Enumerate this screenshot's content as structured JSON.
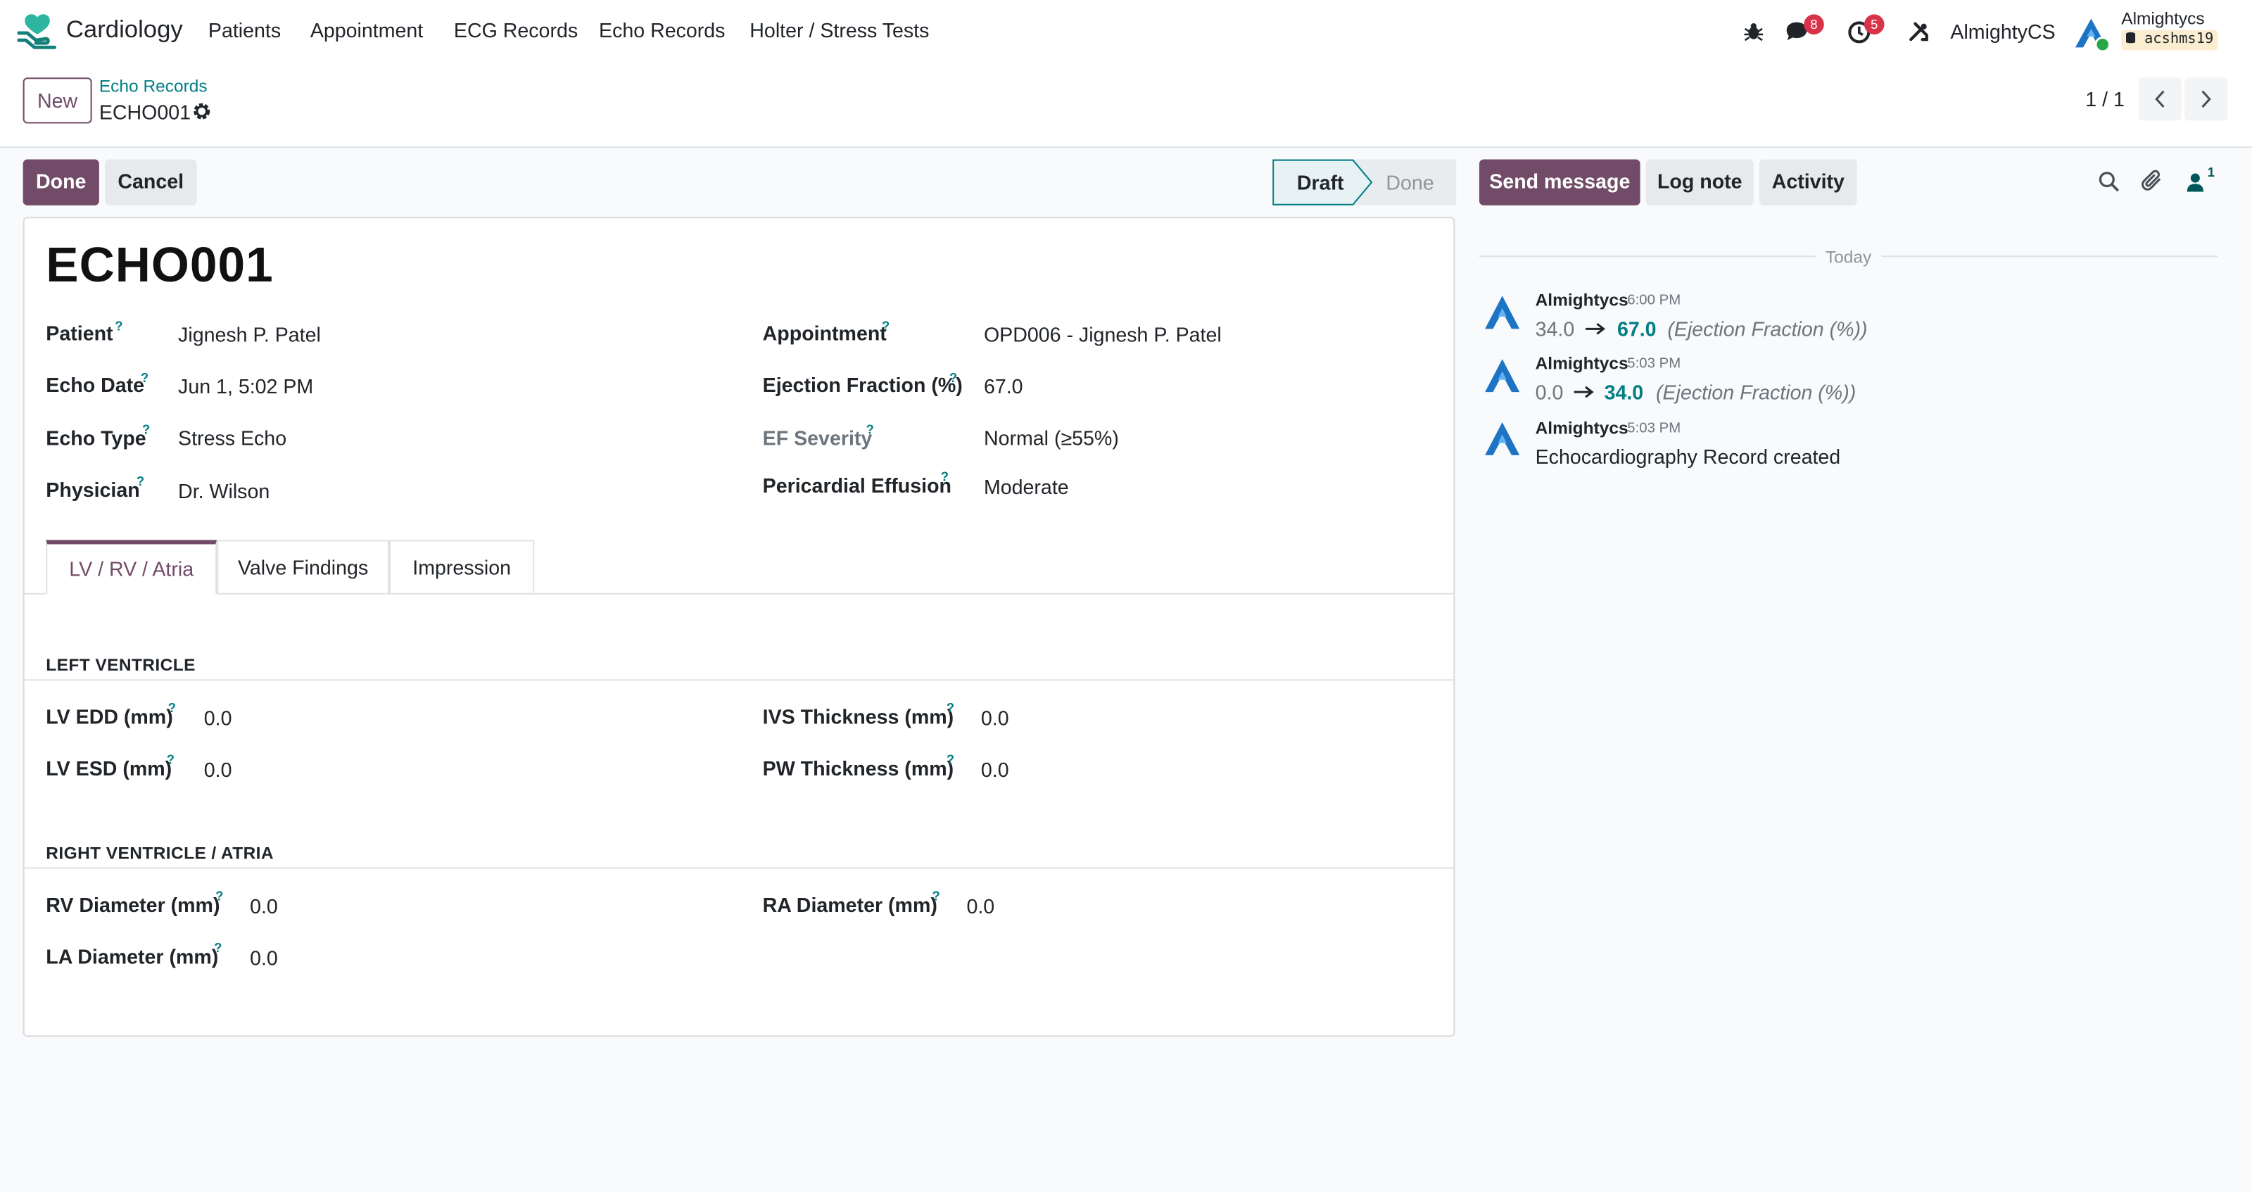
{
  "navbar": {
    "app_name": "Cardiology",
    "menu": [
      "Patients",
      "Appointment",
      "ECG Records",
      "Echo Records",
      "Holter / Stress Tests"
    ],
    "messages_badge": "8",
    "activities_badge": "5",
    "company": "AlmightyCS",
    "user_name": "Almightycs",
    "database": "acshms19"
  },
  "control_panel": {
    "new_label": "New",
    "breadcrumb_parent": "Echo Records",
    "breadcrumb_current": "ECHO001",
    "pager_value": "1 / 1"
  },
  "statusbar": {
    "done_label": "Done",
    "cancel_label": "Cancel",
    "stages": [
      "Draft",
      "Done"
    ],
    "active_stage": "Draft"
  },
  "record": {
    "title": "ECHO001",
    "left_fields": [
      {
        "label": "Patient",
        "value": "Jignesh P. Patel"
      },
      {
        "label": "Echo Date",
        "value": "Jun 1, 5:02 PM"
      },
      {
        "label": "Echo Type",
        "value": "Stress Echo"
      },
      {
        "label": "Physician",
        "value": "Dr. Wilson"
      }
    ],
    "right_fields": [
      {
        "label": "Appointment",
        "value": "OPD006 - Jignesh P. Patel"
      },
      {
        "label": "Ejection Fraction (%)",
        "value": "67.0"
      },
      {
        "label": "EF Severity",
        "value": "Normal (≥55%)"
      },
      {
        "label": "Pericardial Effusion",
        "value": "Moderate"
      }
    ],
    "help_mark": "?"
  },
  "tabs": [
    "LV / RV / Atria",
    "Valve Findings",
    "Impression"
  ],
  "active_tab": "LV / RV / Atria",
  "lv_section": {
    "title": "LEFT VENTRICLE",
    "fields": [
      {
        "label": "LV EDD (mm)",
        "value": "0.0"
      },
      {
        "label": "LV ESD (mm)",
        "value": "0.0"
      },
      {
        "label": "IVS Thickness (mm)",
        "value": "0.0"
      },
      {
        "label": "PW Thickness (mm)",
        "value": "0.0"
      }
    ]
  },
  "rv_section": {
    "title": "RIGHT VENTRICLE / ATRIA",
    "fields": [
      {
        "label": "RV Diameter (mm)",
        "value": "0.0"
      },
      {
        "label": "LA Diameter (mm)",
        "value": "0.0"
      },
      {
        "label": "RA Diameter (mm)",
        "value": "0.0"
      }
    ]
  },
  "chatter": {
    "send_message": "Send message",
    "log_note": "Log note",
    "activity": "Activity",
    "followers_count": "1",
    "date_separator": "Today",
    "messages": [
      {
        "author": "Almightycs",
        "time": "6:00 PM",
        "old": "34.0",
        "new": "67.0",
        "field": "(Ejection Fraction (%))"
      },
      {
        "author": "Almightycs",
        "time": "5:03 PM",
        "old": "0.0",
        "new": "34.0",
        "field": "(Ejection Fraction (%))"
      },
      {
        "author": "Almightycs",
        "time": "5:03 PM",
        "body": "Echocardiography Record created"
      }
    ]
  },
  "colors": {
    "primary": "#714b67",
    "accent_teal": "#017e84",
    "badge_red": "#d9334a"
  }
}
